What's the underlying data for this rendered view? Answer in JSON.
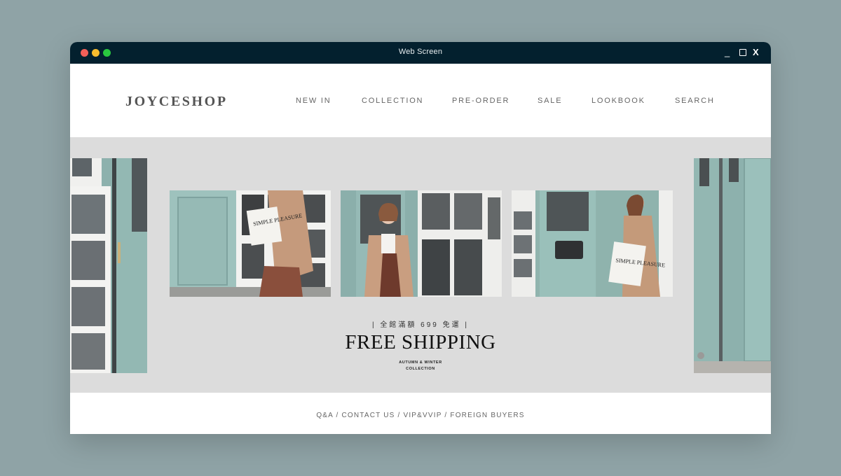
{
  "window": {
    "title": "Web Screen",
    "minimize": "_",
    "close": "X"
  },
  "header": {
    "logo": "JOYCESHOP",
    "nav": [
      "NEW IN",
      "COLLECTION",
      "PRE-ORDER",
      "SALE",
      "LOOKBOOK",
      "SEARCH"
    ]
  },
  "hero": {
    "promo_subtitle": "| 全館滿額 699 免運 |",
    "promo_title": "FREE SHIPPING",
    "caption_line1": "AUTUMN & WINTER",
    "caption_line2": "COLLECTION",
    "bag_text_1": "SIMPLE PLEASURE",
    "bag_text_2": "SIMPLE PLEASURE"
  },
  "footer": {
    "links": [
      "Q&A",
      "CONTACT US",
      "VIP&VVIP",
      "FOREIGN BUYERS"
    ],
    "separator": " / "
  },
  "colors": {
    "page_bg": "#8fa3a6",
    "titlebar": "#03202e",
    "hero_bg": "#dcdcdc",
    "door_teal": "#8eb3af",
    "coat_tan": "#c59a7c"
  }
}
